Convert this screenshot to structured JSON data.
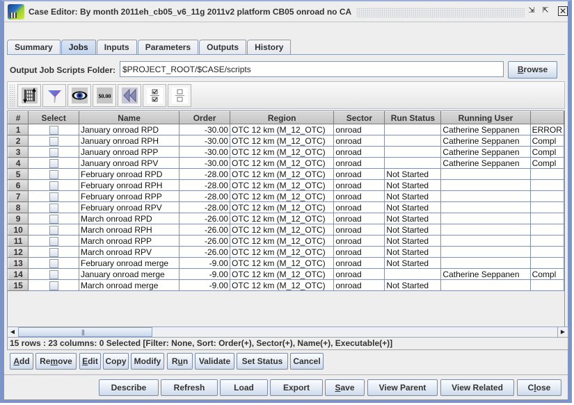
{
  "window": {
    "title": "Case Editor: By month 2011eh_cb05_v6_11g 2011v2 platform CB05 onroad no CA",
    "minimize_icon": "minimize-icon",
    "maximize_icon": "maximize-icon",
    "close_icon": "close-icon",
    "minimize_glyph": "⇲",
    "maximize_glyph": "⇱",
    "close_glyph": "✕"
  },
  "tabs": [
    {
      "label": "Summary",
      "active": false
    },
    {
      "label": "Jobs",
      "active": true
    },
    {
      "label": "Inputs",
      "active": false
    },
    {
      "label": "Parameters",
      "active": false
    },
    {
      "label": "Outputs",
      "active": false
    },
    {
      "label": "History",
      "active": false
    }
  ],
  "folder": {
    "label": "Output Job Scripts Folder:",
    "value": "$PROJECT_ROOT/$CASE/scripts",
    "browse_label": "Browse"
  },
  "toolbar": {
    "buttons": [
      {
        "name": "sort-columns-icon",
        "tooltip": "Sort"
      },
      {
        "name": "filter-icon",
        "tooltip": "Filter"
      },
      {
        "name": "view-eye-icon",
        "tooltip": "Show/Hide Columns"
      },
      {
        "name": "format-currency-icon",
        "label": "$0.00"
      },
      {
        "name": "reset-rewind-icon",
        "tooltip": "Reset"
      },
      {
        "name": "select-all-icon",
        "tooltip": "Select All"
      },
      {
        "name": "clear-selection-icon",
        "tooltip": "Clear All"
      }
    ]
  },
  "table": {
    "columns": [
      "#",
      "Select",
      "Name",
      "Order",
      "Region",
      "Sector",
      "Run Status",
      "Running User",
      ""
    ],
    "rows": [
      {
        "num": "1",
        "name": "January onroad RPD",
        "order": "-30.00",
        "region": "OTC 12 km (M_12_OTC)",
        "sector": "onroad",
        "run_status": "",
        "running_user": "Catherine Seppanen",
        "extra": "ERROR"
      },
      {
        "num": "2",
        "name": "January onroad RPH",
        "order": "-30.00",
        "region": "OTC 12 km (M_12_OTC)",
        "sector": "onroad",
        "run_status": "",
        "running_user": "Catherine Seppanen",
        "extra": "Compl"
      },
      {
        "num": "3",
        "name": "January onroad RPP",
        "order": "-30.00",
        "region": "OTC 12 km (M_12_OTC)",
        "sector": "onroad",
        "run_status": "",
        "running_user": "Catherine Seppanen",
        "extra": "Compl"
      },
      {
        "num": "4",
        "name": "January onroad RPV",
        "order": "-30.00",
        "region": "OTC 12 km (M_12_OTC)",
        "sector": "onroad",
        "run_status": "",
        "running_user": "Catherine Seppanen",
        "extra": "Compl"
      },
      {
        "num": "5",
        "name": "February onroad RPD",
        "order": "-28.00",
        "region": "OTC 12 km (M_12_OTC)",
        "sector": "onroad",
        "run_status": "Not Started",
        "running_user": "",
        "extra": ""
      },
      {
        "num": "6",
        "name": "February onroad RPH",
        "order": "-28.00",
        "region": "OTC 12 km (M_12_OTC)",
        "sector": "onroad",
        "run_status": "Not Started",
        "running_user": "",
        "extra": ""
      },
      {
        "num": "7",
        "name": "February onroad RPP",
        "order": "-28.00",
        "region": "OTC 12 km (M_12_OTC)",
        "sector": "onroad",
        "run_status": "Not Started",
        "running_user": "",
        "extra": ""
      },
      {
        "num": "8",
        "name": "February onroad RPV",
        "order": "-28.00",
        "region": "OTC 12 km (M_12_OTC)",
        "sector": "onroad",
        "run_status": "Not Started",
        "running_user": "",
        "extra": ""
      },
      {
        "num": "9",
        "name": "March onroad RPD",
        "order": "-26.00",
        "region": "OTC 12 km (M_12_OTC)",
        "sector": "onroad",
        "run_status": "Not Started",
        "running_user": "",
        "extra": ""
      },
      {
        "num": "10",
        "name": "March onroad RPH",
        "order": "-26.00",
        "region": "OTC 12 km (M_12_OTC)",
        "sector": "onroad",
        "run_status": "Not Started",
        "running_user": "",
        "extra": ""
      },
      {
        "num": "11",
        "name": "March onroad RPP",
        "order": "-26.00",
        "region": "OTC 12 km (M_12_OTC)",
        "sector": "onroad",
        "run_status": "Not Started",
        "running_user": "",
        "extra": ""
      },
      {
        "num": "12",
        "name": "March onroad RPV",
        "order": "-26.00",
        "region": "OTC 12 km (M_12_OTC)",
        "sector": "onroad",
        "run_status": "Not Started",
        "running_user": "",
        "extra": ""
      },
      {
        "num": "13",
        "name": "February onroad merge",
        "order": "-9.00",
        "region": "OTC 12 km (M_12_OTC)",
        "sector": "onroad",
        "run_status": "Not Started",
        "running_user": "",
        "extra": ""
      },
      {
        "num": "14",
        "name": "January onroad merge",
        "order": "-9.00",
        "region": "OTC 12 km (M_12_OTC)",
        "sector": "onroad",
        "run_status": "",
        "running_user": "Catherine Seppanen",
        "extra": "Compl"
      },
      {
        "num": "15",
        "name": "March onroad merge",
        "order": "-9.00",
        "region": "OTC 12 km (M_12_OTC)",
        "sector": "onroad",
        "run_status": "Not Started",
        "running_user": "",
        "extra": ""
      }
    ]
  },
  "scrollbar": {
    "left_glyph": "◀",
    "right_glyph": "▶"
  },
  "status": "15 rows : 23 columns: 0 Selected [Filter: None, Sort: Order(+), Sector(+), Name(+), Executable(+)]",
  "job_buttons": [
    {
      "label": "Add",
      "mnemonic": "A"
    },
    {
      "label": "Remove",
      "mnemonic": "m"
    },
    {
      "label": "Edit",
      "mnemonic": "E"
    },
    {
      "label": "Copy",
      "mnemonic": ""
    },
    {
      "label": "Modify",
      "mnemonic": ""
    },
    {
      "label": "Run",
      "mnemonic": "u"
    },
    {
      "label": "Validate",
      "mnemonic": ""
    },
    {
      "label": "Set Status",
      "mnemonic": ""
    },
    {
      "label": "Cancel",
      "mnemonic": ""
    }
  ],
  "bottom_buttons": [
    {
      "label": "Describe",
      "mnemonic": ""
    },
    {
      "label": "Refresh",
      "mnemonic": ""
    },
    {
      "label": "Load",
      "mnemonic": ""
    },
    {
      "label": "Export",
      "mnemonic": ""
    },
    {
      "label": "Save",
      "mnemonic": "S"
    },
    {
      "label": "View Parent",
      "mnemonic": ""
    },
    {
      "label": "View Related",
      "mnemonic": ""
    },
    {
      "label": "Close",
      "mnemonic": "l"
    }
  ]
}
